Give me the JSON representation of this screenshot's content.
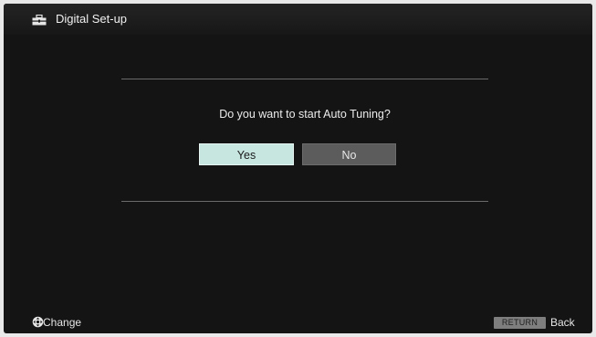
{
  "header": {
    "title": "Digital Set-up",
    "icon": "toolbox-icon"
  },
  "dialog": {
    "question": "Do you want to start Auto Tuning?",
    "buttons": [
      {
        "label": "Yes",
        "selected": true
      },
      {
        "label": "No",
        "selected": false
      }
    ]
  },
  "footer": {
    "change_icon": "dpad-icon",
    "change_label": "Change",
    "return_key": "RETURN",
    "back_label": "Back"
  },
  "colors": {
    "background": "#141414",
    "selected_button": "#c8e6e0",
    "unselected_button": "#5c5c5c",
    "divider": "#6a6a6a"
  }
}
